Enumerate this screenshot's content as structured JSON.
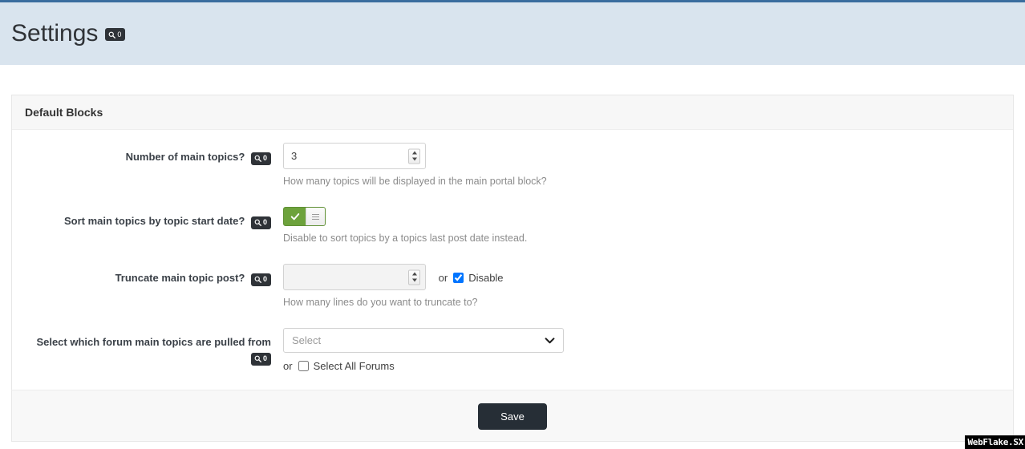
{
  "header": {
    "title": "Settings",
    "badge": {
      "icon": "search-icon",
      "count": "0"
    },
    "bg_color": "#d9e4ee",
    "top_border_color": "#3a6d9e"
  },
  "panel": {
    "heading": "Default Blocks",
    "rows": [
      {
        "label": "Number of main topics?",
        "badge_count": "0",
        "control": "number",
        "value": "3",
        "placeholder": "",
        "help": "How many topics will be displayed in the main portal block?"
      },
      {
        "label": "Sort main topics by topic start date?",
        "badge_count": "0",
        "control": "toggle",
        "toggle_state": "on",
        "toggle_color": "#6da23c",
        "help": "Disable to sort topics by a topics last post date instead."
      },
      {
        "label": "Truncate main topic post?",
        "badge_count": "0",
        "control": "number-disabled",
        "value": "",
        "placeholder": "",
        "or_text": "or",
        "checkbox_label": "Disable",
        "checkbox_checked": true,
        "help": "How many lines do you want to truncate to?"
      },
      {
        "label": "Select which forum main topics are pulled from",
        "badge_count": "0",
        "control": "select",
        "select_placeholder": "Select",
        "or_text": "or",
        "checkbox_label": "Select All Forums",
        "checkbox_checked": false,
        "help": ""
      }
    ]
  },
  "footer": {
    "save_label": "Save",
    "save_color": "#262e36"
  },
  "watermark": {
    "text": "WebFlake.SX"
  }
}
